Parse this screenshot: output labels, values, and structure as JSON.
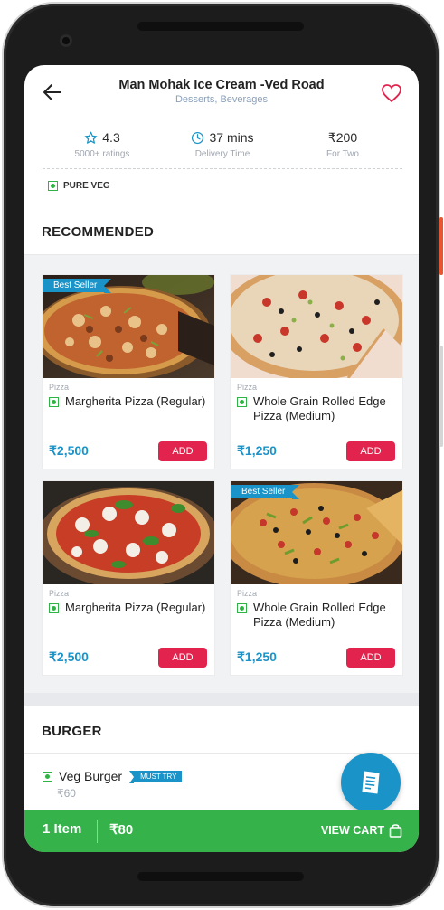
{
  "restaurant": {
    "name": "Man Mohak Ice Cream -Ved Road",
    "cuisines": "Desserts, Beverages"
  },
  "stats": {
    "rating": "4.3",
    "rating_label": "5000+ ratings",
    "delivery_time": "37 mins",
    "delivery_label": "Delivery Time",
    "cost_for_two": "₹200",
    "cost_label": "For Two"
  },
  "pure_veg_label": "PURE VEG",
  "recommended": {
    "title": "RECOMMENDED",
    "items": [
      {
        "badge": "Best Seller",
        "category": "Pizza",
        "name": "Margherita Pizza (Regular)",
        "price": "₹2,500",
        "add_label": "ADD"
      },
      {
        "badge": "",
        "category": "Pizza",
        "name": "Whole Grain Rolled Edge Pizza (Medium)",
        "price": "₹1,250",
        "add_label": "ADD"
      },
      {
        "badge": "",
        "category": "Pizza",
        "name": "Margherita Pizza (Regular)",
        "price": "₹2,500",
        "add_label": "ADD"
      },
      {
        "badge": "Best Seller",
        "category": "Pizza",
        "name": "Whole Grain Rolled Edge Pizza (Medium)",
        "price": "₹1,250",
        "add_label": "ADD"
      }
    ]
  },
  "burger": {
    "title": "BURGER",
    "item_name": "Veg Burger",
    "tag": "MUST TRY",
    "price": "₹60"
  },
  "cart": {
    "items": "1 Item",
    "total": "₹80",
    "view_label": "VIEW CART"
  },
  "colors": {
    "accent": "#1a93c8",
    "add_button": "#e2234d",
    "cart_bar": "#35b34a",
    "veg": "#2fb344",
    "heart": "#e2234d"
  },
  "icons": [
    "back-arrow-icon",
    "heart-icon",
    "star-icon",
    "clock-icon",
    "veg-icon",
    "menu-book-icon",
    "bag-icon"
  ]
}
